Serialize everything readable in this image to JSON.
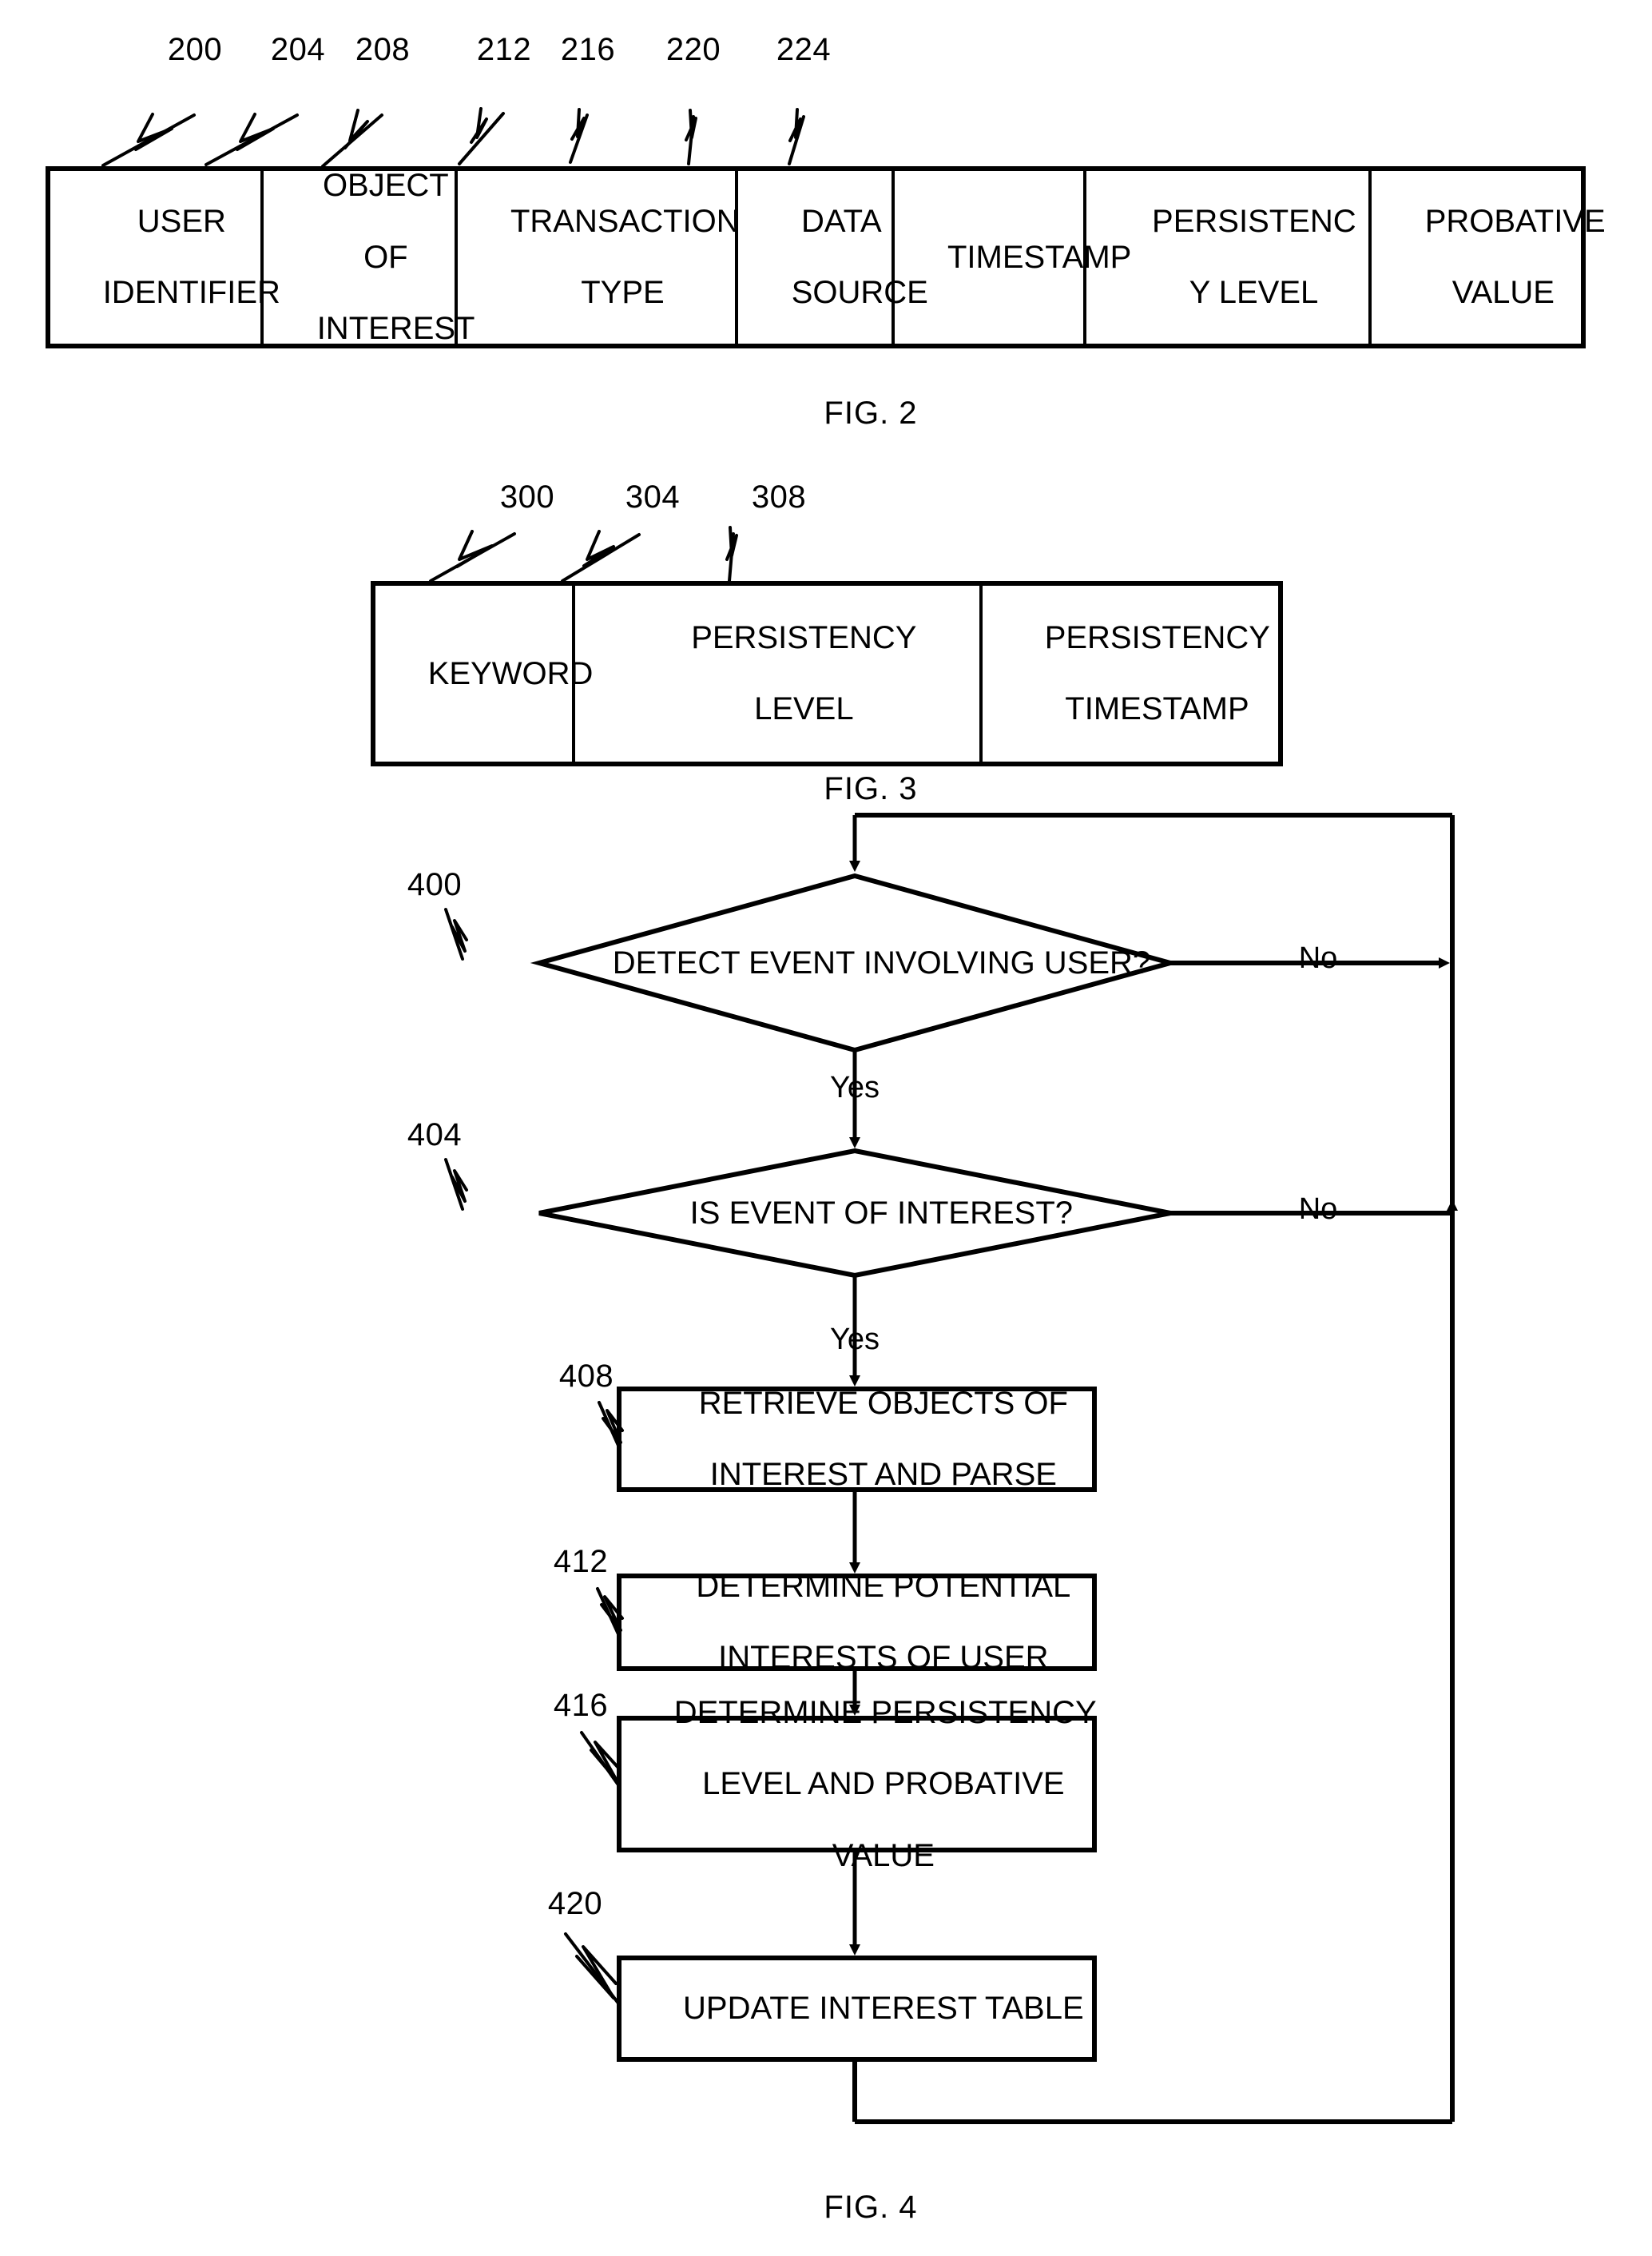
{
  "document": {
    "type": "patent-drawing-sheet",
    "figures": [
      "FIG. 2",
      "FIG. 3",
      "FIG. 4"
    ]
  },
  "fig2": {
    "caption": "FIG. 2",
    "ref_numerals": [
      "200",
      "204",
      "208",
      "212",
      "216",
      "220",
      "224"
    ],
    "columns": [
      {
        "ref": "200",
        "lines": [
          "USER",
          "IDENTIFIER"
        ]
      },
      {
        "ref": "204",
        "lines": [
          "OBJECT",
          "OF",
          "INTEREST"
        ]
      },
      {
        "ref": "208",
        "lines": [
          "TRANSACTION",
          "TYPE"
        ]
      },
      {
        "ref": "212",
        "lines": [
          "DATA",
          "SOURCE"
        ]
      },
      {
        "ref": "216",
        "lines": [
          "TIMESTAMP"
        ]
      },
      {
        "ref": "220",
        "lines": [
          "PERSISTENC",
          "Y LEVEL"
        ]
      },
      {
        "ref": "224",
        "lines": [
          "PROBATIVE",
          "VALUE"
        ]
      }
    ]
  },
  "fig3": {
    "caption": "FIG. 3",
    "ref_numerals": [
      "300",
      "304",
      "308"
    ],
    "columns": [
      {
        "ref": "300",
        "lines": [
          "KEYWORD"
        ]
      },
      {
        "ref": "304",
        "lines": [
          "PERSISTENCY",
          "LEVEL"
        ]
      },
      {
        "ref": "308",
        "lines": [
          "PERSISTENCY",
          "TIMESTAMP"
        ]
      }
    ]
  },
  "fig4": {
    "caption": "FIG. 4",
    "nodes": [
      {
        "ref": "400",
        "shape": "decision",
        "lines": [
          "DETECT EVENT INVOLVING USER?"
        ]
      },
      {
        "ref": "404",
        "shape": "decision",
        "lines": [
          "IS EVENT OF INTEREST?"
        ]
      },
      {
        "ref": "408",
        "shape": "process",
        "lines": [
          "RETRIEVE OBJECTS OF",
          "INTEREST AND PARSE"
        ]
      },
      {
        "ref": "412",
        "shape": "process",
        "lines": [
          "DETERMINE POTENTIAL",
          "INTERESTS OF USER"
        ]
      },
      {
        "ref": "416",
        "shape": "process",
        "lines": [
          "DETERMINE PERSISTENCY",
          "LEVEL AND PROBATIVE",
          "VALUE"
        ]
      },
      {
        "ref": "420",
        "shape": "process",
        "lines": [
          "UPDATE INTEREST TABLE"
        ]
      }
    ],
    "branch_labels": {
      "d400_no": "No",
      "d400_yes": "Yes",
      "d404_no": "No",
      "d404_yes": "Yes"
    }
  },
  "style": {
    "ink": "#000000",
    "paper": "#ffffff"
  }
}
